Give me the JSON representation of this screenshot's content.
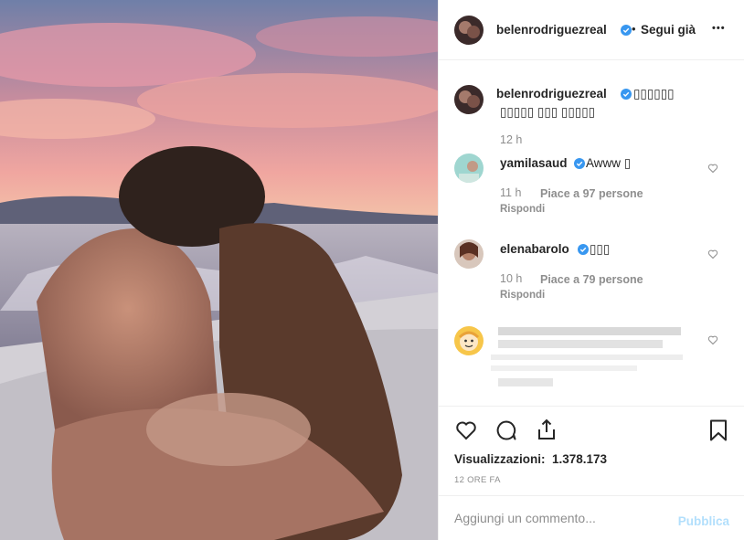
{
  "post": {
    "author": "belenrodriguezreal",
    "follow_label": "Segui già",
    "options_label": "•••",
    "dot": "•"
  },
  "caption": {
    "username": "belenrodriguezreal",
    "line1": "▯▯▯▯▯▯",
    "line2": "▯▯▯▯▯ ▯▯▯ ▯▯▯▯▯",
    "time": "12 h"
  },
  "comments": [
    {
      "username": "yamilasaud",
      "text": "Awww ▯",
      "time": "11 h",
      "likes": "Piace a 97 persone",
      "reply": "Rispondi"
    },
    {
      "username": "elenabarolo",
      "text": "▯▯▯",
      "time": "10 h",
      "likes": "Piace a 79 persone",
      "reply": "Rispondi"
    }
  ],
  "stats": {
    "views_label": "Visualizzazioni:",
    "views_value": "1.378.173",
    "posted": "12 ORE FA"
  },
  "comment_box": {
    "placeholder": "Aggiungi un commento...",
    "publish_label": "Pubblica"
  },
  "colors": {
    "verified": "#3897f0",
    "publish_disabled": "#b2dffc",
    "meta": "#8e8e8e"
  }
}
